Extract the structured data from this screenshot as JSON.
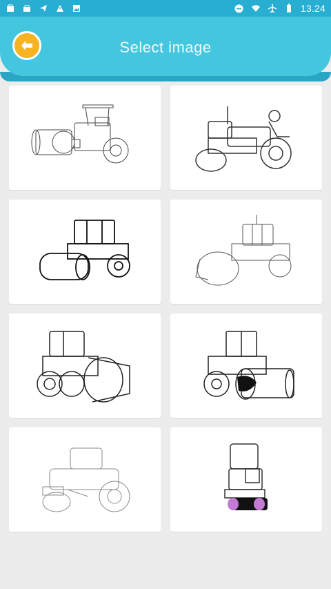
{
  "status_bar": {
    "time": "13.24",
    "left_icons": [
      "shop-icon",
      "bag-icon",
      "send-icon",
      "warning-icon",
      "image-icon"
    ],
    "right_icons": [
      "dnd-icon",
      "wifi-icon",
      "airplane-icon",
      "battery-icon"
    ]
  },
  "header": {
    "title": "Select image",
    "back_icon": "arrow-left-icon"
  },
  "images": [
    {
      "name": "road-roller-1"
    },
    {
      "name": "road-roller-2"
    },
    {
      "name": "road-roller-3"
    },
    {
      "name": "road-roller-4"
    },
    {
      "name": "road-roller-5"
    },
    {
      "name": "road-roller-6"
    },
    {
      "name": "road-roller-7"
    },
    {
      "name": "road-roller-8"
    }
  ],
  "colors": {
    "status_bar": "#27aed1",
    "header": "#45c6df",
    "back_button": "#f7b321",
    "background": "#ececec",
    "accent_purple": "#c47bd6"
  }
}
